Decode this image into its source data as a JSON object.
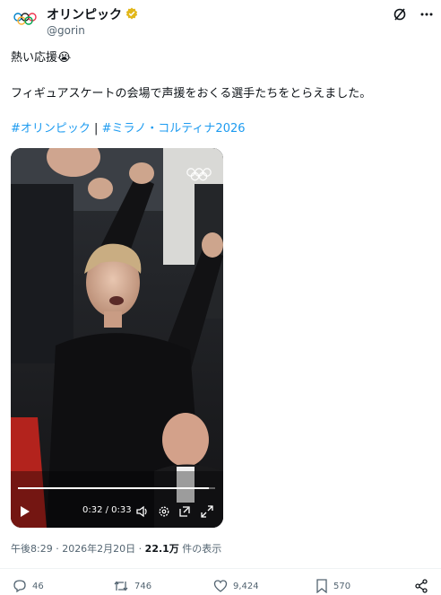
{
  "account": {
    "display_name": "オリンピック",
    "handle": "@gorin"
  },
  "post": {
    "line1": "熱い応援",
    "line1_emoji": "😭",
    "line2": "フィギュアスケートの会場で声援をおくる選手たちをとらえました。",
    "hashtag1": "#オリンピック",
    "separator": "|",
    "hashtag2": "#ミラノ・コルティナ2026"
  },
  "video": {
    "time": "0:32 / 0:33",
    "progress": 0.97
  },
  "meta": {
    "timestamp": "午後8:29 · 2026年2月20日 · ",
    "views_count": "22.1万",
    "views_label": " 件の表示"
  },
  "actions": {
    "replies": "46",
    "reposts": "746",
    "likes": "9,424",
    "bookmarks": "570"
  },
  "colors": {
    "accent": "#1d9bf0",
    "verified_gold": "#e2b719",
    "muted": "#536471"
  }
}
